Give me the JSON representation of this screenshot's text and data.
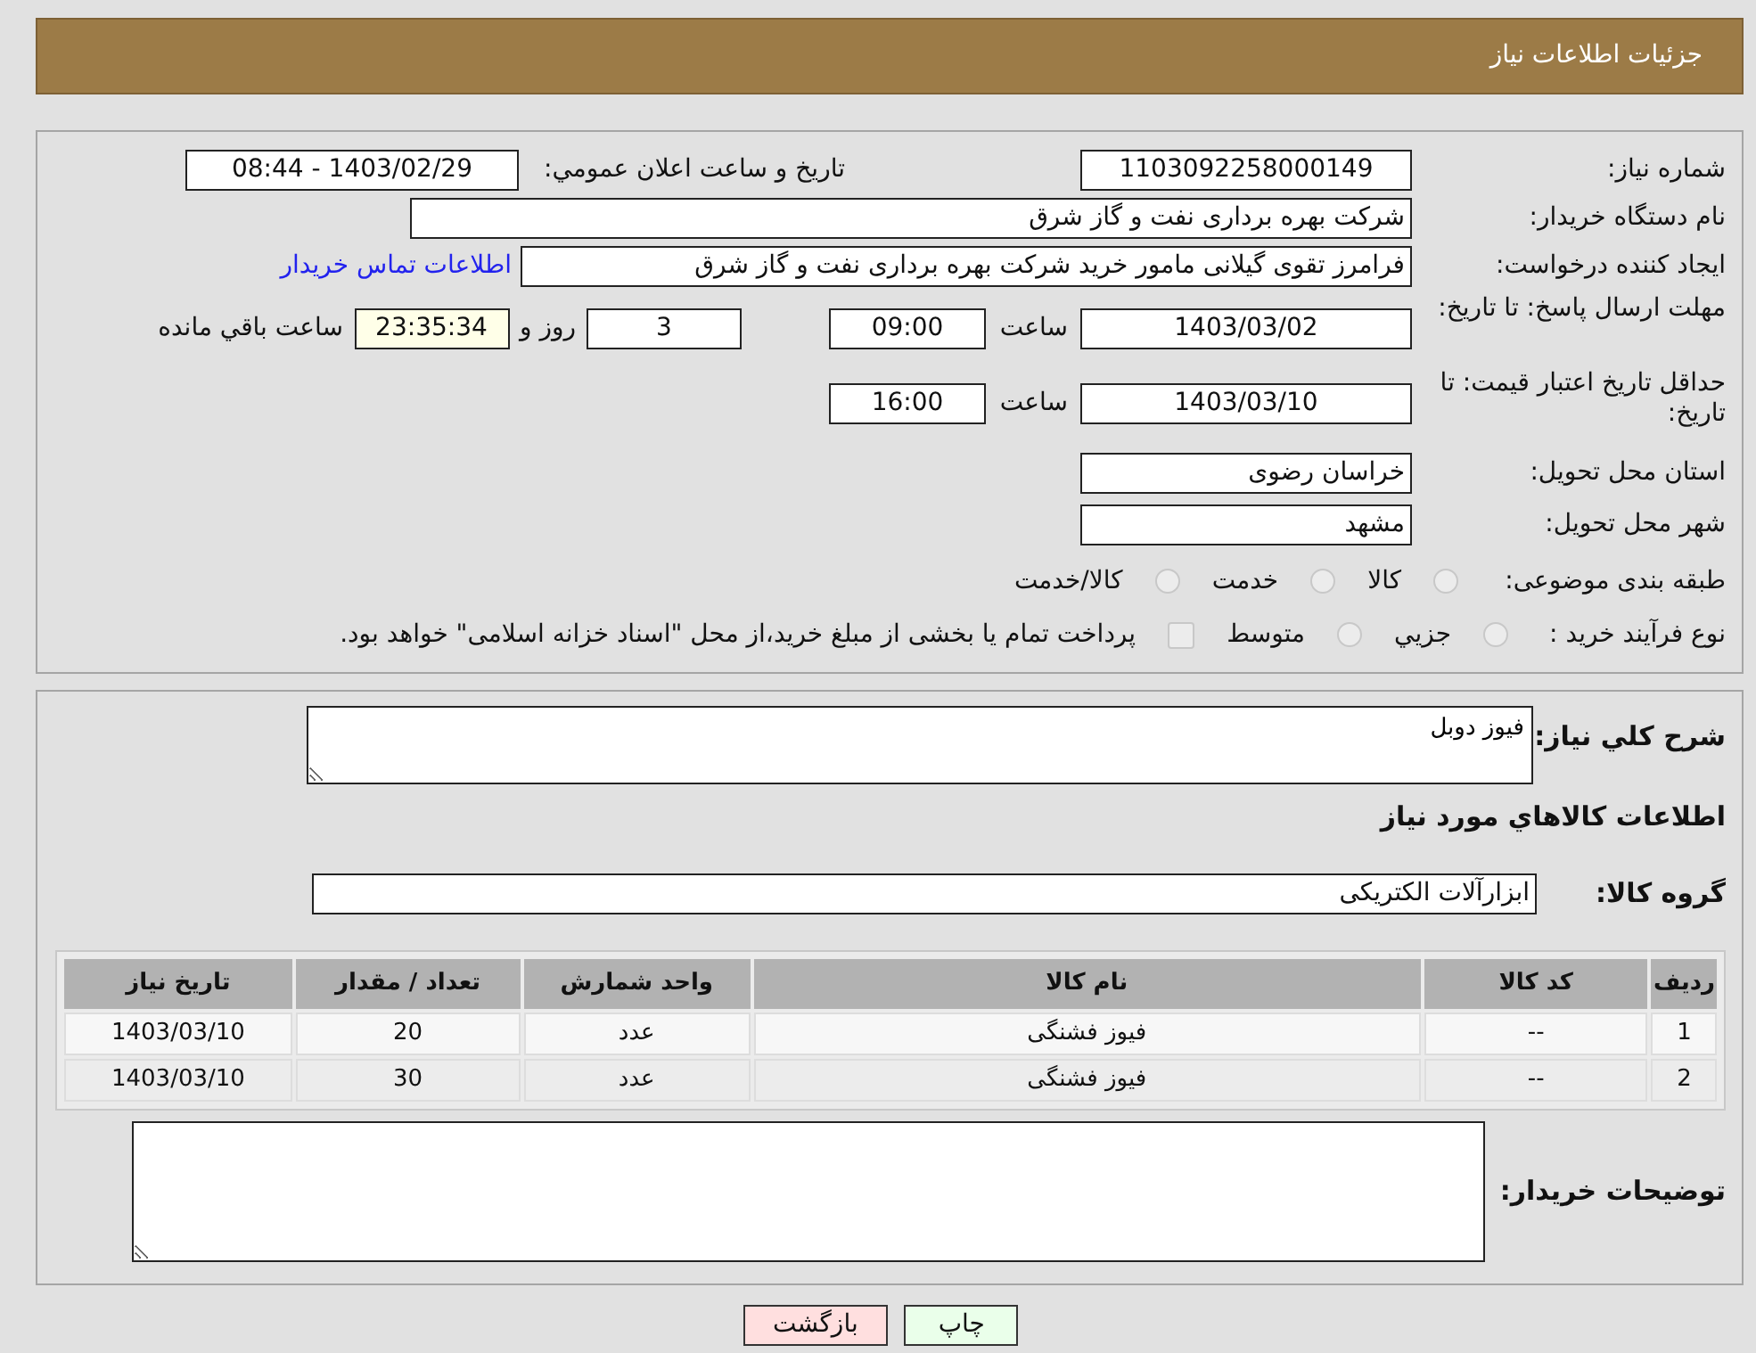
{
  "header": {
    "title": "جزئیات اطلاعات نیاز"
  },
  "need_number": {
    "label": "شماره نیاز:",
    "value": "1103092258000149"
  },
  "announcement": {
    "label": "تاریخ و ساعت اعلان عمومي:",
    "value": "1403/02/29 - 08:44"
  },
  "buyer_org": {
    "label": "نام دستگاه خریدار:",
    "value": "شرکت بهره برداری نفت و گاز شرق"
  },
  "creator": {
    "label": "ایجاد کننده درخواست:",
    "value": "فرامرز تقوی گیلانی مامور خرید شرکت بهره برداری نفت و گاز شرق",
    "link": "اطلاعات تماس خریدار"
  },
  "reply_deadline": {
    "label": "مهلت ارسال پاسخ: تا تاریخ:",
    "date": "1403/03/02",
    "time_label": "ساعت",
    "time": "09:00",
    "days": "3",
    "days_label": "روز و",
    "remaining": "23:35:34",
    "remaining_label": "ساعت باقي مانده"
  },
  "price_validity": {
    "label": "حداقل تاریخ اعتبار قیمت: تا تاریخ:",
    "date": "1403/03/10",
    "time_label": "ساعت",
    "time": "16:00"
  },
  "province": {
    "label": "استان محل تحویل:",
    "value": "خراسان رضوی"
  },
  "city": {
    "label": "شهر محل تحویل:",
    "value": "مشهد"
  },
  "category": {
    "label": "طبقه بندی موضوعی:",
    "options": [
      {
        "label": "کالا",
        "selected": false
      },
      {
        "label": "خدمت",
        "selected": false
      },
      {
        "label": "کالا/خدمت",
        "selected": false
      }
    ]
  },
  "purchase_type": {
    "label": "نوع فرآیند خرید :",
    "options": [
      {
        "label": "جزیي",
        "selected": false
      },
      {
        "label": "متوسط",
        "selected": false
      }
    ],
    "payment": {
      "label": "پرداخت تمام یا بخشی از مبلغ خرید،از محل \"اسناد خزانه اسلامی\" خواهد بود.",
      "checked": false
    }
  },
  "description": {
    "label": "شرح کلي نیاز:",
    "value": "فیوز دوبل"
  },
  "goods_title": "اطلاعات کالاهاي مورد نیاز",
  "goods_group": {
    "label": "گروه کالا:",
    "value": "ابزارآلات الکتریکی"
  },
  "table": {
    "columns": [
      "ردیف",
      "کد کالا",
      "نام کالا",
      "واحد شمارش",
      "تعداد / مقدار",
      "تاریخ نیاز"
    ],
    "rows": [
      [
        "1",
        "--",
        "فیوز فشنگی",
        "عدد",
        "20",
        "1403/03/10"
      ],
      [
        "2",
        "--",
        "فیوز فشنگی",
        "عدد",
        "30",
        "1403/03/10"
      ]
    ]
  },
  "buyer_notes": {
    "label": "توضیحات خریدار:"
  },
  "buttons": [
    {
      "label": "چاپ",
      "kind": "print"
    },
    {
      "label": "بازگشت",
      "kind": "back"
    }
  ]
}
